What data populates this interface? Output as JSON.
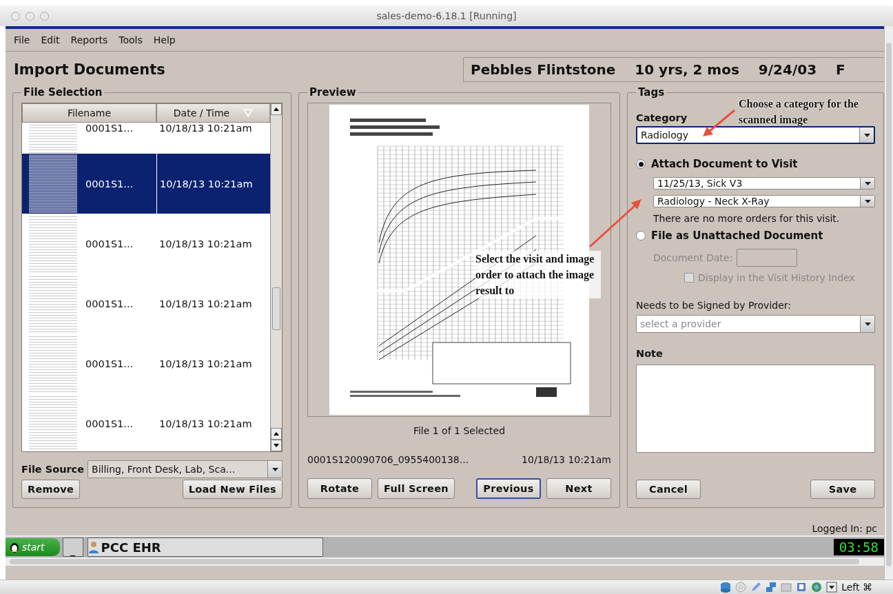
{
  "window": {
    "title": "sales-demo-6.18.1 [Running]"
  },
  "menu": [
    "File",
    "Edit",
    "Reports",
    "Tools",
    "Help"
  ],
  "page_title": "Import Documents",
  "patient": {
    "name": "Pebbles Flintstone",
    "age": "10 yrs, 2 mos",
    "dob": "9/24/03",
    "sex": "F"
  },
  "file_selection": {
    "legend": "File Selection",
    "columns": [
      "Filename",
      "Date / Time"
    ],
    "rows": [
      {
        "filename": "0001S1...",
        "date": "10/18/13 10:21am",
        "selected": false
      },
      {
        "filename": "0001S1...",
        "date": "10/18/13 10:21am",
        "selected": true
      },
      {
        "filename": "0001S1...",
        "date": "10/18/13 10:21am",
        "selected": false
      },
      {
        "filename": "0001S1...",
        "date": "10/18/13 10:21am",
        "selected": false
      },
      {
        "filename": "0001S1...",
        "date": "10/18/13 10:21am",
        "selected": false
      },
      {
        "filename": "0001S1...",
        "date": "10/18/13 10:21am",
        "selected": false
      }
    ],
    "source_label": "File Source",
    "source_value": "Billing, Front Desk, Lab, Sca...",
    "buttons": [
      "Remove",
      "Load New Files"
    ]
  },
  "preview": {
    "legend": "Preview",
    "status": "File 1 of 1 Selected",
    "filename": "0001S120090706_0955400138...",
    "date": "10/18/13 10:21am",
    "buttons": [
      {
        "label": "Rotate",
        "focused": false
      },
      {
        "label": "Full Screen",
        "focused": false
      },
      {
        "label": "Previous",
        "focused": true
      },
      {
        "label": "Next",
        "focused": false
      }
    ]
  },
  "tags": {
    "legend": "Tags",
    "category_label": "Category",
    "category_value": "Radiology",
    "attach": {
      "label": "Attach Document to Visit",
      "selected": true,
      "visit": "11/25/13, Sick V3",
      "order": "Radiology - Neck X-Ray",
      "message": "There are no more orders for this visit."
    },
    "unattached": {
      "label": "File as Unattached Document",
      "selected": false,
      "disabled": true,
      "date_label": "Document Date:",
      "index_label": "Display in the Visit History Index",
      "index_checked": false
    },
    "provider_label": "Needs to be Signed by Provider:",
    "provider_placeholder": "select a provider",
    "note_label": "Note",
    "buttons": [
      "Cancel",
      "Save"
    ]
  },
  "annotations": [
    "Choose a category for the scanned image",
    "Select the visit and image order to attach the image result to"
  ],
  "logged_in": "Logged In: pc",
  "taskbar": {
    "start": "start",
    "minimize": "_",
    "task": "PCC EHR",
    "clock": "03:58"
  },
  "status_bar": {
    "host_key": "Left ⌘"
  }
}
